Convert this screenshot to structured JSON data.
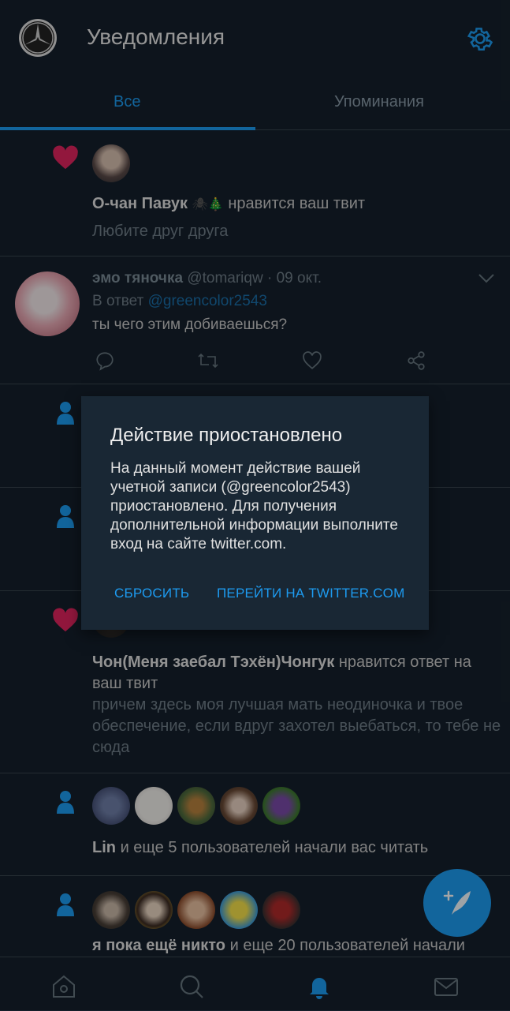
{
  "header": {
    "title": "Уведомления"
  },
  "tabs": [
    {
      "label": "Все"
    },
    {
      "label": "Упоминания"
    }
  ],
  "feed": {
    "like1": {
      "user": "О-чан Павук",
      "action": "нравится ваш твит",
      "tweet": "Любите друг друга"
    },
    "reply": {
      "name": "эмо тяночка",
      "handle": "@tomariqw",
      "date": "· 09 окт.",
      "reply_prefix": "В ответ",
      "reply_to": "@greencolor2543",
      "text": "ты чего этим добиваешься?"
    },
    "like2": {
      "user": "Чон(Меня заебал Тэхён)Чонгук",
      "action": "нравится ответ на ваш твит",
      "tweet": "причем здесь моя лучшая мать неодиночка и твое обеспечение, если вдруг захотел выебаться, то тебе не сюда"
    },
    "follow1": {
      "user": "Lin",
      "action": "и еще 5 пользователей начали вас читать"
    },
    "follow2": {
      "user": "я пока ещё никто",
      "action": "и еще 20 пользователей начали"
    }
  },
  "dialog": {
    "title": "Действие приостановлено",
    "body": "На данный момент действие вашей учетной записи (@greencolor2543) приостановлено. Для получения дополнительной информации выполните вход на сайте twitter.com.",
    "btn_reset": "СБРОСИТЬ",
    "btn_go": "ПЕРЕЙТИ НА TWITTER.COM"
  },
  "colors": {
    "background": "#15202b",
    "accent": "#1d9bf0",
    "like": "#e0245e"
  }
}
